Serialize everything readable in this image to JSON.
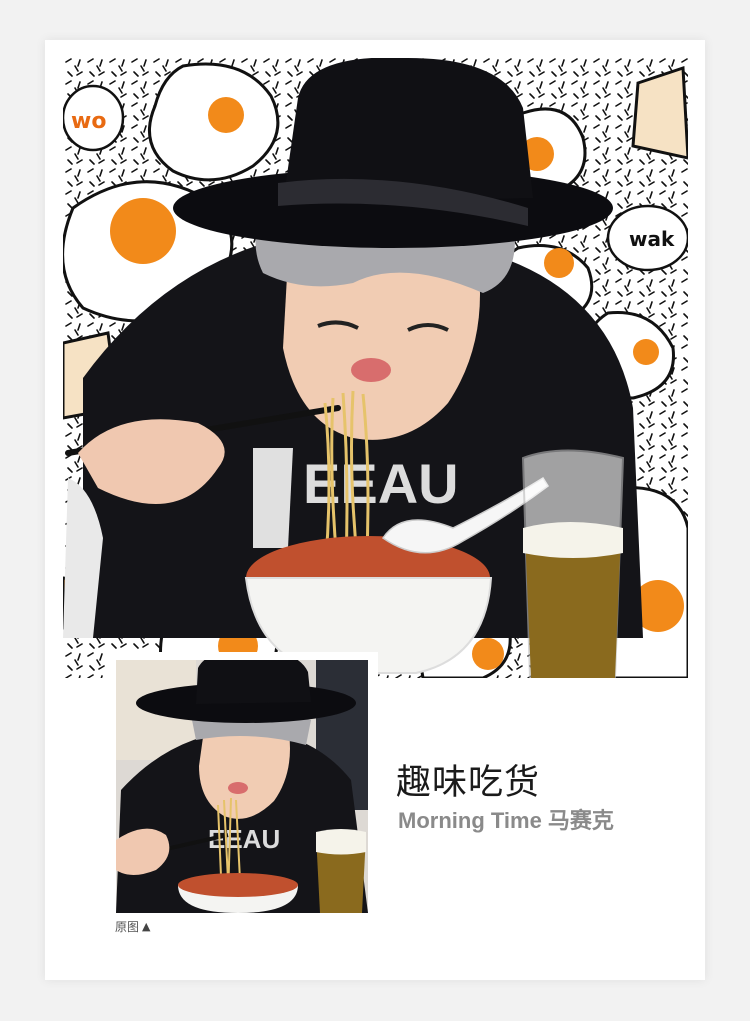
{
  "card": {
    "title": "趣味吃货",
    "subtitle": "Morning Time 马赛克",
    "thumbnail_caption": "原图",
    "thumbnail_caption_icon": "triangle-up-icon"
  },
  "main_image": {
    "description_icon": "photo-with-egg-doodles",
    "doodle_text_left": "wo",
    "doodle_text_right": "wak"
  },
  "colors": {
    "background": "#f2f2f2",
    "card": "#ffffff",
    "title": "#1a1a1a",
    "subtitle": "#8a8a8a",
    "egg_yolk": "#f28a1a"
  }
}
